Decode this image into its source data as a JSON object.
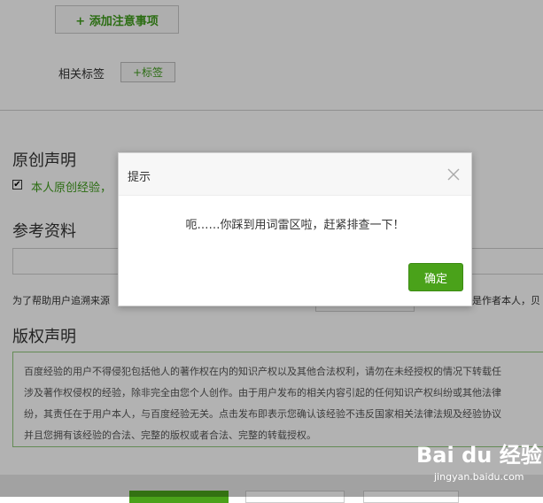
{
  "editor": {
    "add_note_label": "+ 添加注意事项",
    "tags_label": "相关标签",
    "add_tag_label": "+标签"
  },
  "original": {
    "title": "原创声明",
    "checkbox_label": "本人原创经验，"
  },
  "reference": {
    "title": "参考资料",
    "help_text_left": "为了帮助用户追溯来源",
    "help_text_right": "是作者本人，贝"
  },
  "copyright": {
    "title": "版权声明",
    "lines": [
      "百度经验的用户不得侵犯包括他人的著作权在内的知识产权以及其他合法权利，请勿在未经授权的情况下转载任",
      "涉及著作权侵权的经验，除非完全由您个人创作。由于用户发布的相关内容引起的任何知识产权纠纷或其他法律",
      "纷，其责任在于用户本人，与百度经验无关。点击发布即表示您确认该经验不违反国家相关法律法规及经验协议",
      "并且您拥有该经验的合法、完整的版权或者合法、完整的转载授权。"
    ]
  },
  "dialog": {
    "title": "提示",
    "message": "呃……你踩到用词雷区啦，赶紧排查一下！",
    "ok_label": "确定"
  },
  "watermark": {
    "logo_text": "Bai du 经验",
    "sub_text": "jingyan.baidu.com"
  },
  "colors": {
    "accent_green": "#4aa21a",
    "text_green": "#3f9c1c",
    "overlay": "rgba(0,0,0,0.3)"
  },
  "icons": {
    "checkbox": "checkmark-icon",
    "close": "close-icon"
  }
}
